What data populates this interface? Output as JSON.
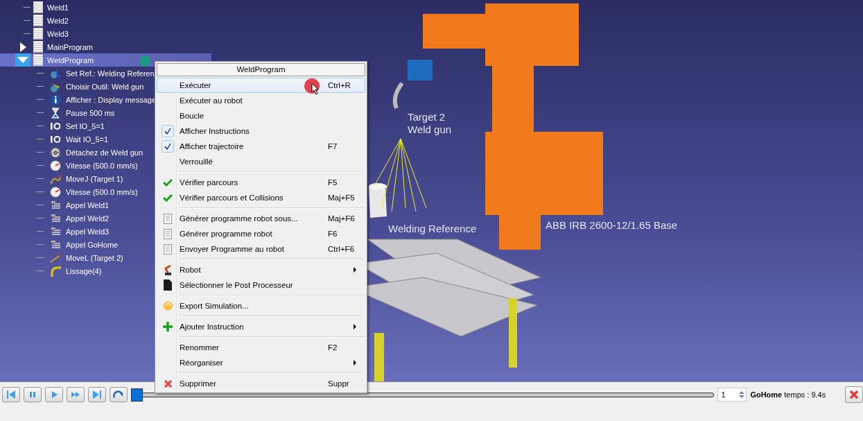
{
  "tree": {
    "items": [
      {
        "label": "Weld1",
        "kind": "program",
        "selected": false
      },
      {
        "label": "Weld2",
        "kind": "program",
        "selected": false
      },
      {
        "label": "Weld3",
        "kind": "program",
        "selected": false
      },
      {
        "label": "MainProgram",
        "kind": "program",
        "expanded": false,
        "selected": false
      },
      {
        "label": "WeldProgram",
        "kind": "program",
        "expanded": true,
        "selected": true,
        "children": [
          {
            "label": "Set Ref.: Welding Referen",
            "kind": "frame"
          },
          {
            "label": "Choisir Outil: Weld gun",
            "kind": "tool"
          },
          {
            "label": "Afficher : Display message",
            "kind": "info"
          },
          {
            "label": "Pause 500 ms",
            "kind": "pause"
          },
          {
            "label": "Set IO_5=1",
            "kind": "io"
          },
          {
            "label": "Wait IO_5=1",
            "kind": "io"
          },
          {
            "label": "Détachez de Weld gun",
            "kind": "detach"
          },
          {
            "label": "Vitesse (500.0 mm/s)",
            "kind": "speed"
          },
          {
            "label": "MoveJ (Target 1)",
            "kind": "movej"
          },
          {
            "label": "Vitesse (500.0 mm/s)",
            "kind": "speed"
          },
          {
            "label": "Appel Weld1",
            "kind": "call"
          },
          {
            "label": "Appel Weld2",
            "kind": "call"
          },
          {
            "label": "Appel Weld3",
            "kind": "call"
          },
          {
            "label": "Appel GoHome",
            "kind": "call"
          },
          {
            "label": "MoveL (Target 2)",
            "kind": "movel"
          },
          {
            "label": "Lissage(4)",
            "kind": "smoothing"
          }
        ]
      }
    ]
  },
  "viewport": {
    "labels": [
      {
        "text": "Target 2",
        "kind": "target"
      },
      {
        "text": "Weld gun",
        "kind": "tool"
      },
      {
        "text": "Welding Reference",
        "kind": "reference"
      },
      {
        "text": "ABB IRB 2600-12/1.65 Base",
        "kind": "robot"
      }
    ]
  },
  "context_menu": {
    "title": "WeldProgram",
    "groups": [
      [
        {
          "label": "Exécuter",
          "shortcut": "Ctrl+R",
          "kind": "plain",
          "selected": true
        },
        {
          "label": "Exécuter au robot",
          "kind": "plain",
          "selected": false
        },
        {
          "label": "Boucle",
          "kind": "toggle",
          "checked": false,
          "selected": false
        },
        {
          "label": "Afficher Instructions",
          "kind": "toggle",
          "checked": true,
          "selected": false
        },
        {
          "label": "Afficher trajectoire",
          "shortcut": "F7",
          "kind": "toggle",
          "checked": true,
          "selected": false
        },
        {
          "label": "Verrouillé",
          "kind": "toggle",
          "checked": false,
          "selected": false
        }
      ],
      [
        {
          "label": "Vérifier parcours",
          "shortcut": "F5",
          "kind": "check",
          "selected": false
        },
        {
          "label": "Vérifier parcours et Collisions",
          "shortcut": "Maj+F5",
          "kind": "check",
          "selected": false
        }
      ],
      [
        {
          "label": "Générer programme robot sous...",
          "shortcut": "Maj+F6",
          "kind": "document",
          "selected": false
        },
        {
          "label": "Générer programme robot",
          "shortcut": "F6",
          "kind": "document",
          "selected": false
        },
        {
          "label": "Envoyer Programme au robot",
          "shortcut": "Ctrl+F6",
          "kind": "document",
          "selected": false
        }
      ],
      [
        {
          "label": "Robot",
          "kind": "robot",
          "submenu": true,
          "selected": false
        },
        {
          "label": "Sélectionner le Post Processeur",
          "kind": "file",
          "selected": false
        }
      ],
      [
        {
          "label": "Export Simulation...",
          "kind": "export",
          "selected": false
        }
      ],
      [
        {
          "label": "Ajouter Instruction",
          "kind": "add",
          "submenu": true,
          "selected": false
        }
      ],
      [
        {
          "label": "Renommer",
          "shortcut": "F2",
          "kind": "plain",
          "selected": false
        },
        {
          "label": "Réorganiser",
          "kind": "plain",
          "submenu": true,
          "selected": false
        }
      ],
      [
        {
          "label": "Supprimer",
          "shortcut": "Suppr",
          "kind": "delete",
          "selected": false
        }
      ]
    ]
  },
  "playback": {
    "buttons": [
      {
        "kind": "first"
      },
      {
        "kind": "pause"
      },
      {
        "kind": "play"
      },
      {
        "kind": "fast"
      },
      {
        "kind": "last"
      },
      {
        "kind": "loop"
      }
    ],
    "timeline": {
      "level": 0
    },
    "speed": "1",
    "status": "**GoHome** temps : 9.4s"
  }
}
